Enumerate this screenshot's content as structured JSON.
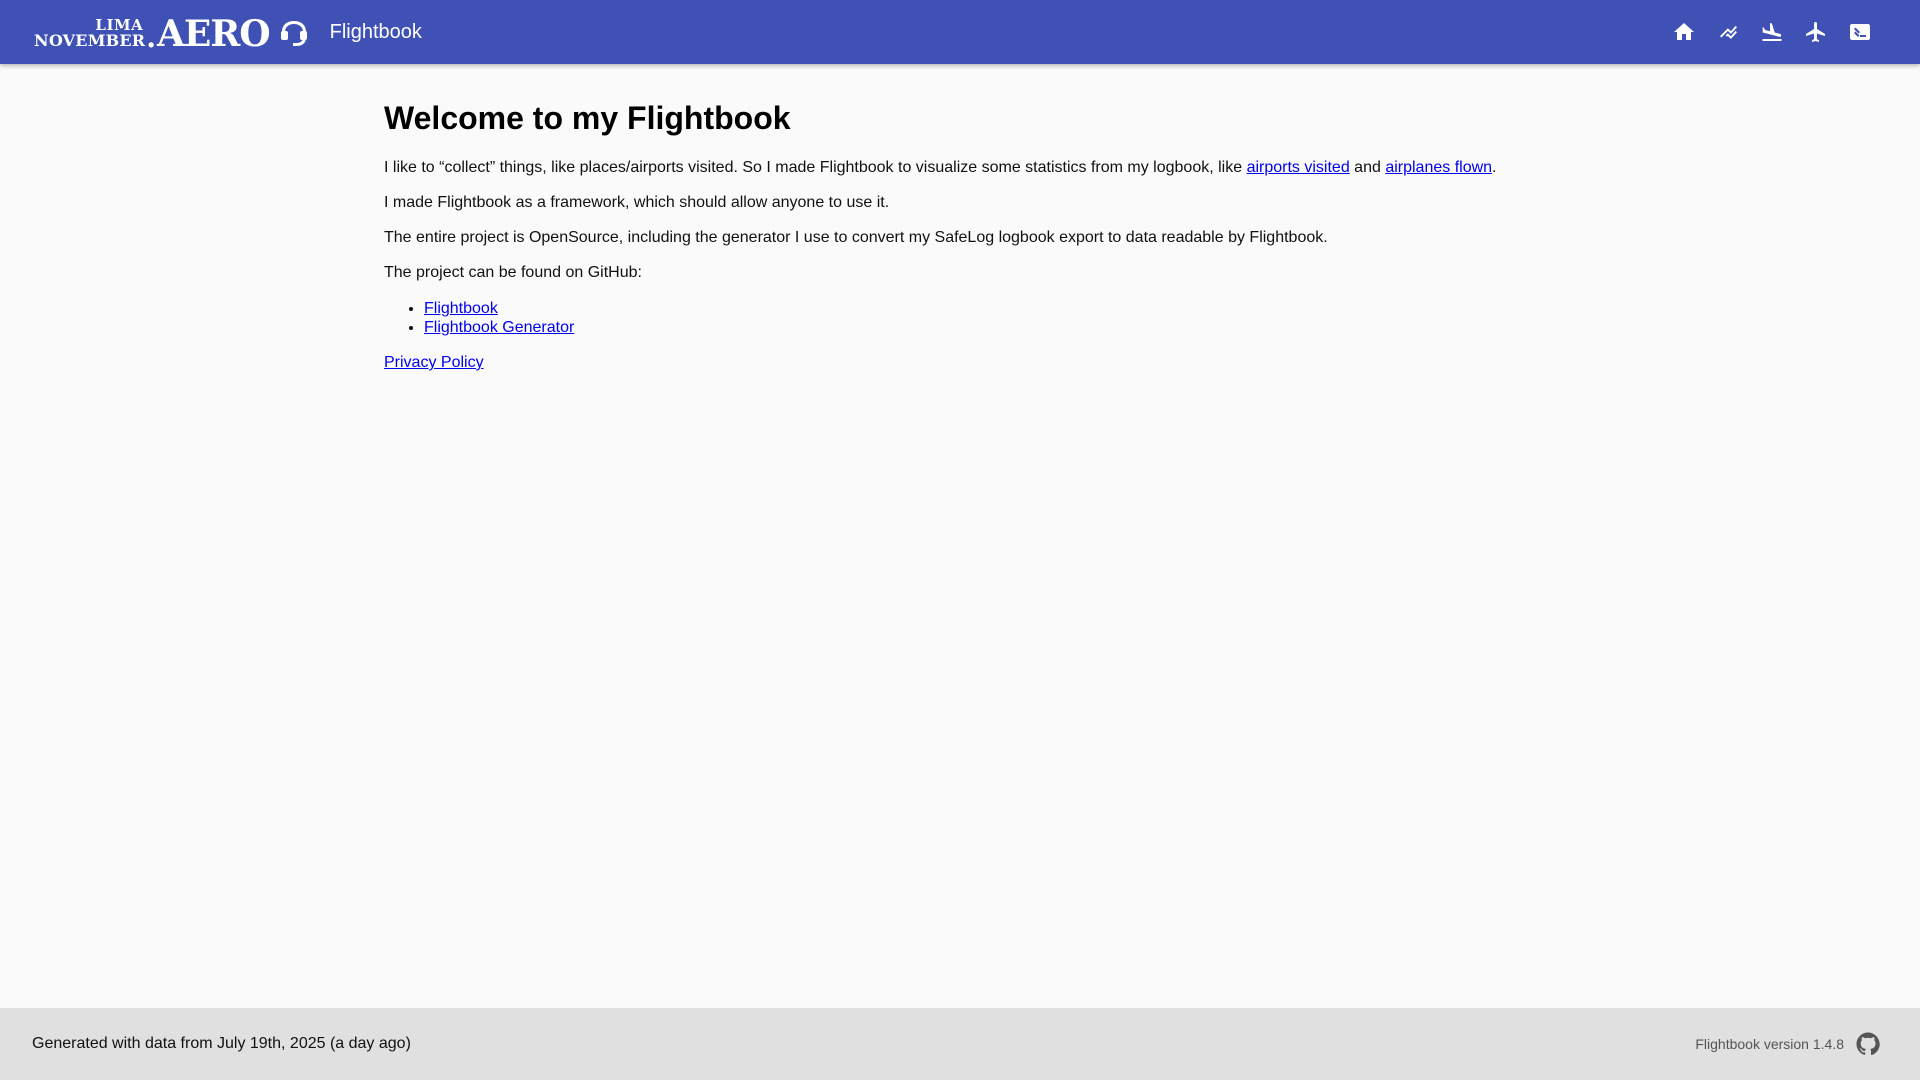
{
  "header": {
    "logo": {
      "lima": "LIMA",
      "november": "NOVEMBER",
      "dot": ".",
      "aero": "AERO"
    },
    "app_title": "Flightbook",
    "nav": [
      {
        "icon": "home-icon"
      },
      {
        "icon": "stats-icon"
      },
      {
        "icon": "flight-land-icon"
      },
      {
        "icon": "airplane-icon"
      },
      {
        "icon": "terminal-icon"
      }
    ],
    "bar_color": "#3f51b5"
  },
  "main": {
    "title": "Welcome to my Flightbook",
    "para1_start": "I like to “collect” things, like places/airports visited. So I made Flightbook to visualize some statistics from my logbook, like ",
    "para1_link1": "airports visited",
    "para1_mid": " and ",
    "para1_link2": "airplanes flown",
    "para1_end": ".",
    "para2": "I made Flightbook as a framework, which should allow anyone to use it.",
    "para3": "The entire project is OpenSource, including the generator I use to convert my SafeLog logbook export to data readable by Flightbook.",
    "para4": "The project can be found on GitHub:",
    "github_links": [
      {
        "label": "Flightbook"
      },
      {
        "label": "Flightbook Generator"
      }
    ],
    "privacy_link": "Privacy Policy"
  },
  "footer": {
    "generated": "Generated with data from July 19th, 2025 (a day ago)",
    "version": "Flightbook version 1.4.8",
    "icon": "github-icon"
  }
}
